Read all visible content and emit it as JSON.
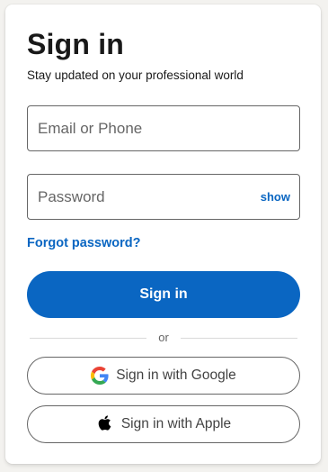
{
  "header": {
    "title": "Sign in",
    "subtitle": "Stay updated on your professional world"
  },
  "form": {
    "email_placeholder": "Email or Phone",
    "password_placeholder": "Password",
    "show_label": "show",
    "forgot_label": "Forgot password?",
    "submit_label": "Sign in"
  },
  "divider": {
    "label": "or"
  },
  "oauth": {
    "google_label": "Sign in with Google",
    "google_icon": "google-g-icon",
    "apple_label": "Sign in with Apple",
    "apple_icon": "apple-logo-icon"
  },
  "colors": {
    "primary": "#0a66c2",
    "text": "#000000e6",
    "muted": "#666666",
    "background": "#f3f2ef",
    "card": "#ffffff"
  }
}
